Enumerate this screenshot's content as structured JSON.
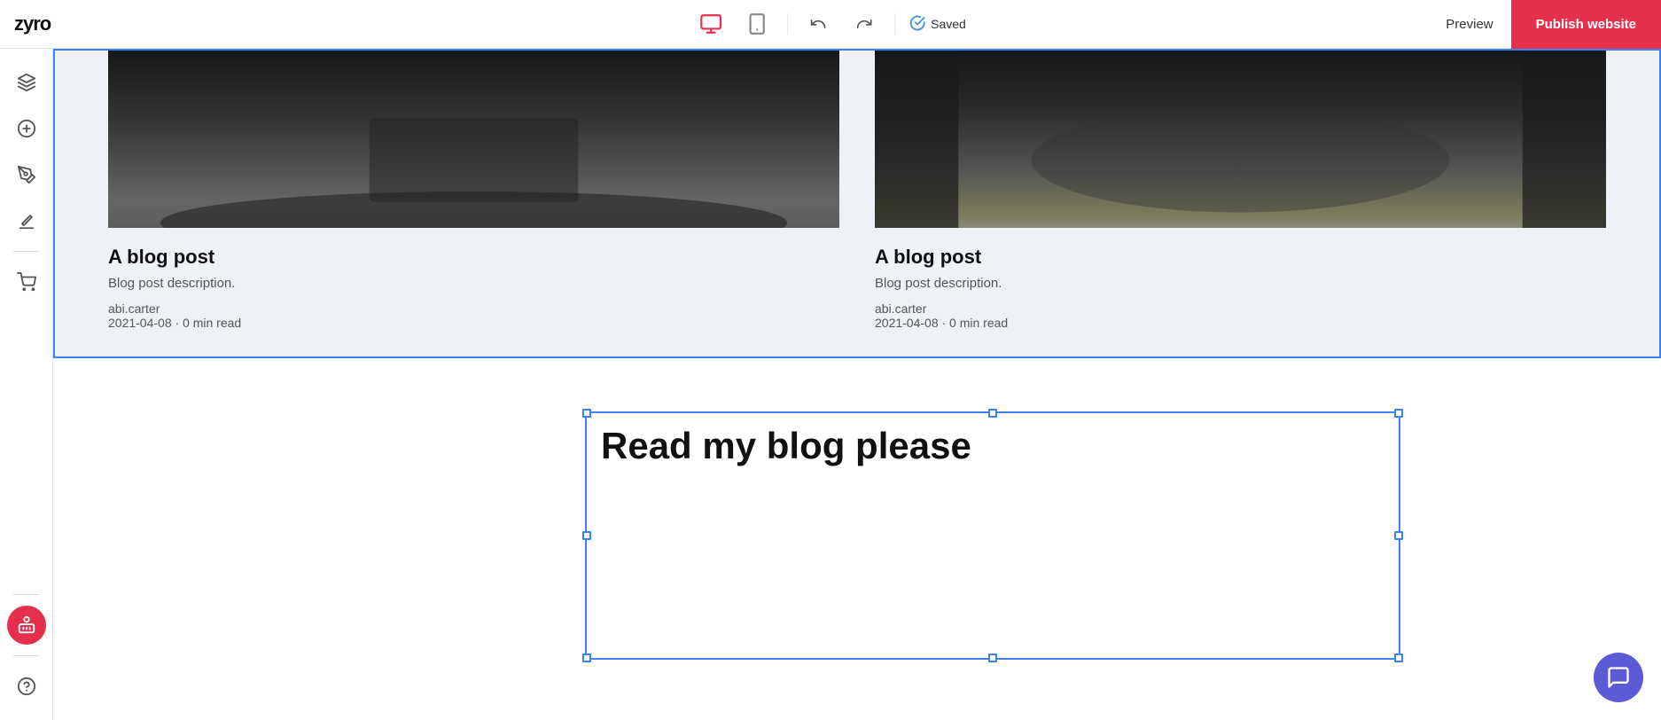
{
  "topbar": {
    "logo": "zyro",
    "devices": [
      {
        "id": "desktop",
        "label": "Desktop",
        "active": true
      },
      {
        "id": "mobile",
        "label": "Mobile",
        "active": false
      }
    ],
    "undo_label": "Undo",
    "redo_label": "Redo",
    "saved_label": "Saved",
    "preview_label": "Preview",
    "publish_label": "Publish website"
  },
  "sidebar": {
    "items": [
      {
        "id": "layers",
        "label": "Layers"
      },
      {
        "id": "add",
        "label": "Add element"
      },
      {
        "id": "draw",
        "label": "Draw"
      },
      {
        "id": "edit",
        "label": "Edit"
      },
      {
        "id": "cart",
        "label": "Cart"
      }
    ],
    "ai_label": "AI Assistant",
    "help_label": "Help"
  },
  "blog_posts": [
    {
      "title": "A blog post",
      "description": "Blog post description.",
      "author": "abi.carter",
      "date": "2021-04-08",
      "read_time": "0 min read",
      "meta": "2021-04-08 · 0 min read"
    },
    {
      "title": "A blog post",
      "description": "Blog post description.",
      "author": "abi.carter",
      "date": "2021-04-08",
      "read_time": "0 min read",
      "meta": "2021-04-08 · 0 min read"
    }
  ],
  "text_element": {
    "content": "Read my blog please"
  }
}
